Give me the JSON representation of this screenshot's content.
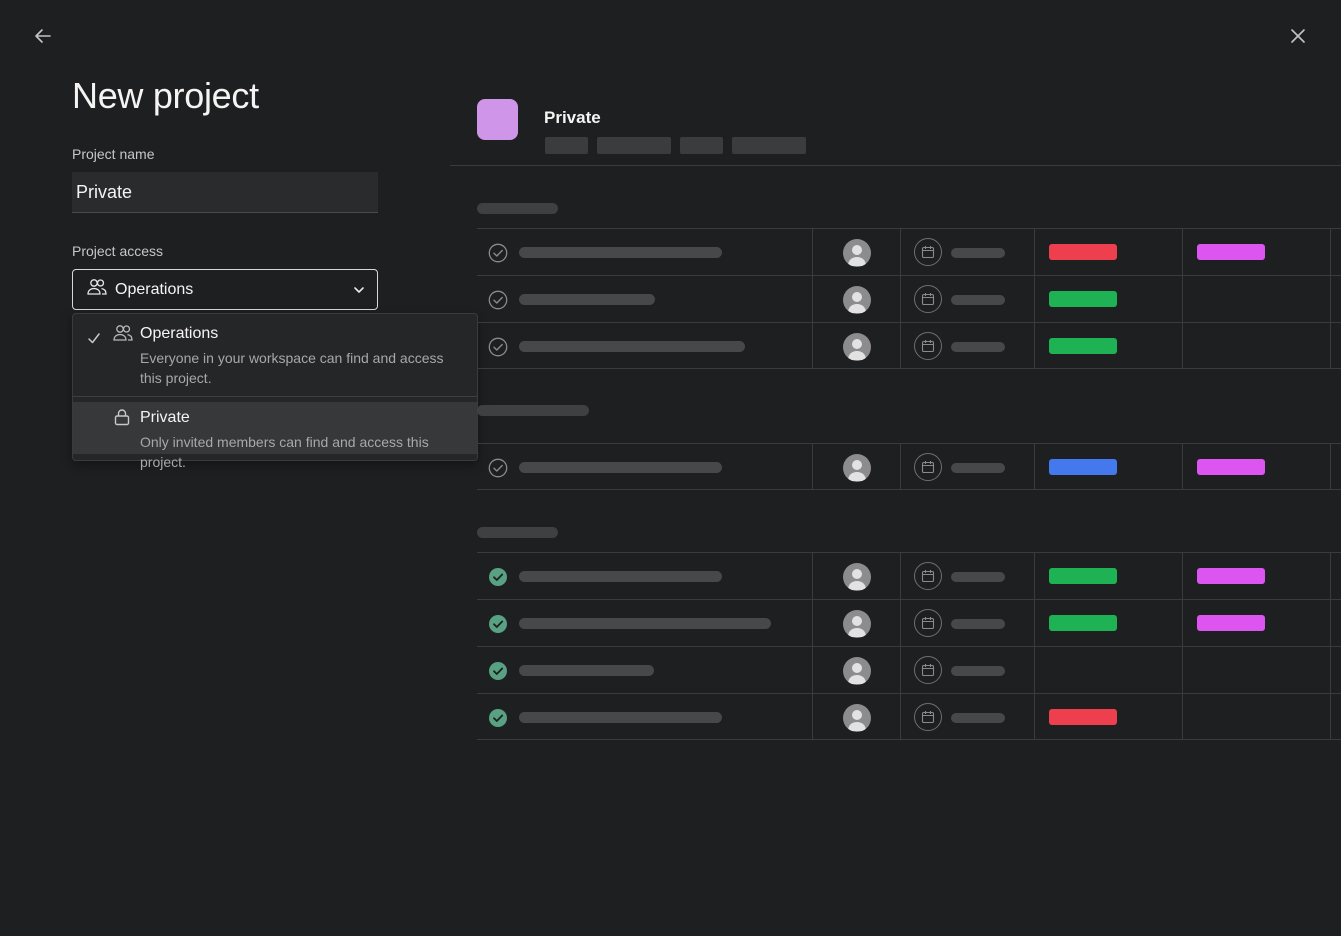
{
  "page": {
    "title": "New project"
  },
  "form": {
    "name_label": "Project name",
    "name_value": "Private",
    "access_label": "Project access",
    "access_selected": "Operations"
  },
  "dropdown": {
    "options": [
      {
        "title": "Operations",
        "description": "Everyone in your workspace can find and access this project.",
        "icon": "team-icon",
        "selected": true
      },
      {
        "title": "Private",
        "description": "Only invited members can find and access this project.",
        "icon": "lock-icon",
        "selected": false
      }
    ]
  },
  "preview": {
    "project_name": "Private",
    "swatch_color": "#cf95e8",
    "colors": {
      "red": "#ee3f4f",
      "green": "#1fb254",
      "blue": "#4479ed",
      "magenta": "#dc55f0",
      "done_check": "#58a182"
    }
  }
}
